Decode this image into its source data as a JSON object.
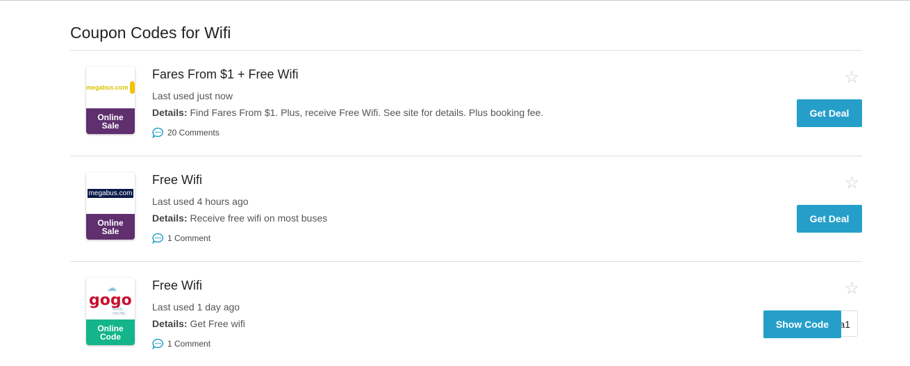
{
  "heading": "Coupon Codes for Wifi",
  "coupons": [
    {
      "logo_text": "megabus.com",
      "badge": "Online Sale",
      "badge_color": "#5f2f6e",
      "title": "Fares From $1 + Free Wifi",
      "used": "Last used just now",
      "details_label": "Details:",
      "details": "Find Fares From $1. Plus, receive Free Wifi. See site for details. Plus booking fee.",
      "comments": "20 Comments",
      "button": "Get Deal"
    },
    {
      "logo_text": "megabus.com",
      "badge": "Online Sale",
      "badge_color": "#5f2f6e",
      "title": "Free Wifi",
      "used": "Last used 4 hours ago",
      "details_label": "Details:",
      "details": "Receive free wifi on most buses",
      "comments": "1 Comment",
      "button": "Get Deal"
    },
    {
      "logo_text": "gogo",
      "logo_sub": "IN AIR. ONLINE.",
      "badge": "Online Code",
      "badge_color": "#14b58a",
      "title": "Free Wifi",
      "used": "Last used 1 day ago",
      "details_label": "Details:",
      "details": "Get Free wifi",
      "comments": "1 Comment",
      "button": "Show Code",
      "code_peek": "a1"
    }
  ],
  "accent": "#259fc9"
}
